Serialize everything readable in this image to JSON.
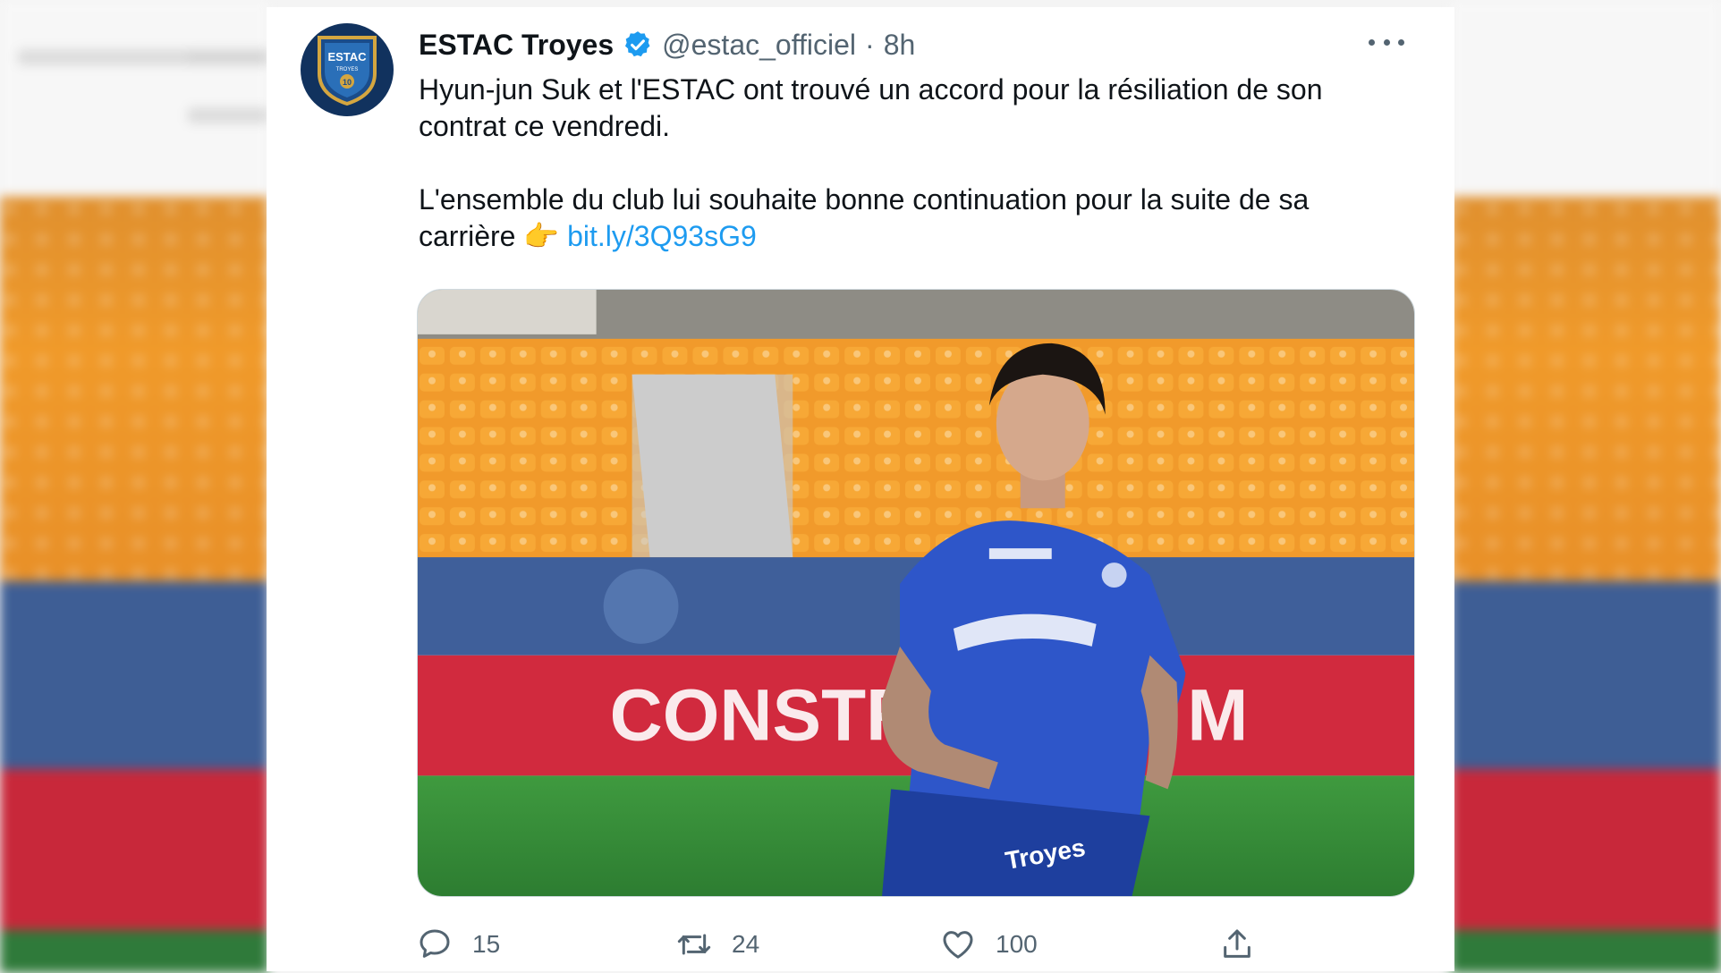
{
  "tweet": {
    "display_name": "ESTAC Troyes",
    "handle": "@estac_officiel",
    "separator": "·",
    "time": "8h",
    "text_line1": "Hyun-jun Suk et l'ESTAC ont trouvé un accord pour la résiliation de son contrat ce vendredi.",
    "text_line2": "L'ensemble du club lui souhaite bonne continuation pour la suite de sa carrière 👉",
    "link": "bit.ly/3Q93sG9",
    "avatar_text": "ESTAC",
    "avatar_subtext": "TROYES",
    "avatar_number": "10"
  },
  "media": {
    "banner_text": "CONSTR     UR DE M",
    "jersey_sponsor": "Troyes"
  },
  "actions": {
    "replies": "15",
    "retweets": "24",
    "likes": "100"
  },
  "icons": {
    "verified": "verified-badge-icon",
    "more": "more-options-icon",
    "reply": "reply-icon",
    "retweet": "retweet-icon",
    "like": "heart-icon",
    "share": "share-icon"
  },
  "colors": {
    "link": "#1d9bf0",
    "secondary_text": "#536471",
    "primary_text": "#0f1419",
    "avatar_bg": "#11325e"
  }
}
